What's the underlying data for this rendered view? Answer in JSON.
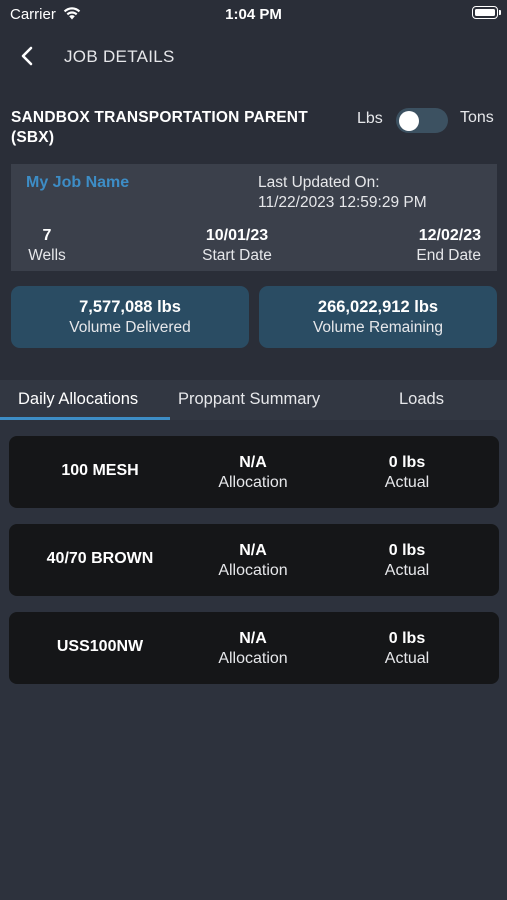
{
  "status_bar": {
    "carrier": "Carrier",
    "time": "1:04 PM"
  },
  "nav": {
    "title": "JOB DETAILS",
    "back_icon": "chevron-left-icon"
  },
  "header": {
    "company": "SANDBOX TRANSPORTATION PARENT (SBX)",
    "unit_left": "Lbs",
    "unit_right": "Tons",
    "toggle_on": false
  },
  "job": {
    "name": "My Job Name",
    "updated_label": "Last Updated On:",
    "updated_value": "11/22/2023 12:59:29 PM",
    "wells": {
      "value": "7",
      "label": "Wells"
    },
    "start": {
      "value": "10/01/23",
      "label": "Start Date"
    },
    "end": {
      "value": "12/02/23",
      "label": "End Date"
    }
  },
  "volume": {
    "delivered": {
      "value": "7,577,088 lbs",
      "label": "Volume Delivered"
    },
    "remaining": {
      "value": "266,022,912 lbs",
      "label": "Volume Remaining"
    }
  },
  "tabs": [
    {
      "label": "Daily Allocations",
      "active": true
    },
    {
      "label": "Proppant Summary",
      "active": false
    },
    {
      "label": "Loads",
      "active": false
    }
  ],
  "allocations": [
    {
      "name": "100 MESH",
      "allocation": "N/A",
      "allocation_label": "Allocation",
      "actual": "0 lbs",
      "actual_label": "Actual"
    },
    {
      "name": "40/70 BROWN",
      "allocation": "N/A",
      "allocation_label": "Allocation",
      "actual": "0 lbs",
      "actual_label": "Actual"
    },
    {
      "name": "USS100NW",
      "allocation": "N/A",
      "allocation_label": "Allocation",
      "actual": "0 lbs",
      "actual_label": "Actual"
    }
  ],
  "colors": {
    "background": "#2d323d",
    "header_bg": "#2a2e38",
    "accent": "#3d8dc6",
    "volume_card": "#2a4c63",
    "row_card": "#151618"
  }
}
